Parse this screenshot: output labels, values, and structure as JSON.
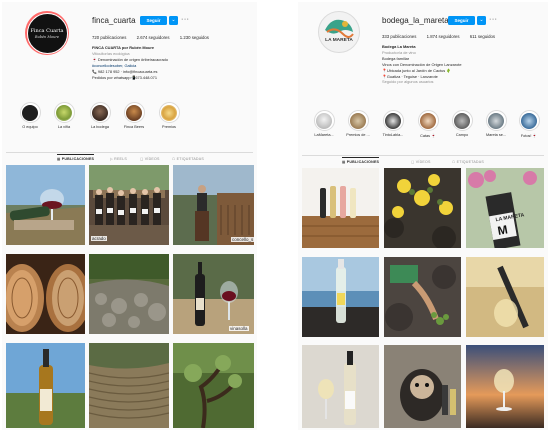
{
  "left_profile": {
    "username": "finca_cuarta",
    "follow_label": "Seguir",
    "more_label": "···",
    "stats": {
      "posts": "720 publicaciones",
      "followers": "2.674 seguidores",
      "following": "1.230 seguidos"
    },
    "bio": {
      "name": "FINCA CUARTA por Rubén Moure",
      "category": "Viticultor/as ecológica",
      "line1": "🍷 Denominación de origen #ribeiracacrado",
      "line2": "#concellodesober, Galicia",
      "line3": "📞 982 178 952 · info@fincacuarta.es",
      "line4": "Pedidos por whatsapp📲673.448.071"
    },
    "avatar_text": "Finca Cuarta",
    "avatar_signature": "Rubén Moure",
    "highlights": [
      {
        "label": "O equipo"
      },
      {
        "label": "La viña"
      },
      {
        "label": "La bodega"
      },
      {
        "label": "Finca Beers"
      },
      {
        "label": "Premios"
      }
    ],
    "tabs": [
      {
        "label": "▦ PUBLICACIONES"
      },
      {
        "label": "▷ REELS"
      },
      {
        "label": "▢ VÍDEOS"
      },
      {
        "label": "☖ ETIQUETADAS"
      }
    ],
    "post_tags": {
      "p2": "acrado",
      "p3": "concello_s",
      "p6": "vinasolla"
    }
  },
  "right_profile": {
    "username": "bodega_la_mareta",
    "follow_label": "Seguir",
    "more_label": "···",
    "stats": {
      "posts": "333 publicaciones",
      "followers": "1.874 seguidores",
      "following": "611 seguidos"
    },
    "bio": {
      "name": "Bodega La Mareta",
      "category": "Productor/a de vino",
      "line1": "Bodega familiar",
      "line2": "Vinos con Denominación de Origen Lanzarote",
      "line3": "📍Ubicada junto al Jardín de Cactus 🌵",
      "line4": "📍Guatiza · Teguise · Lanzarote",
      "line5": "Seguido por algunos usuarios"
    },
    "avatar_text": "LA MARETA",
    "highlights": [
      {
        "label": "LaMareta..."
      },
      {
        "label": "Premios de ..."
      },
      {
        "label": "TintoLabla..."
      },
      {
        "label": "Catas 🍷"
      },
      {
        "label": "Campo"
      },
      {
        "label": "Mareta se..."
      },
      {
        "label": "Fotos! 🍷"
      }
    ],
    "tabs": [
      {
        "label": "▦ PUBLICACIONES"
      },
      {
        "label": "▢ VÍDEOS"
      },
      {
        "label": "☖ ETIQUETADAS"
      }
    ],
    "label_text": "LA MARETA"
  }
}
